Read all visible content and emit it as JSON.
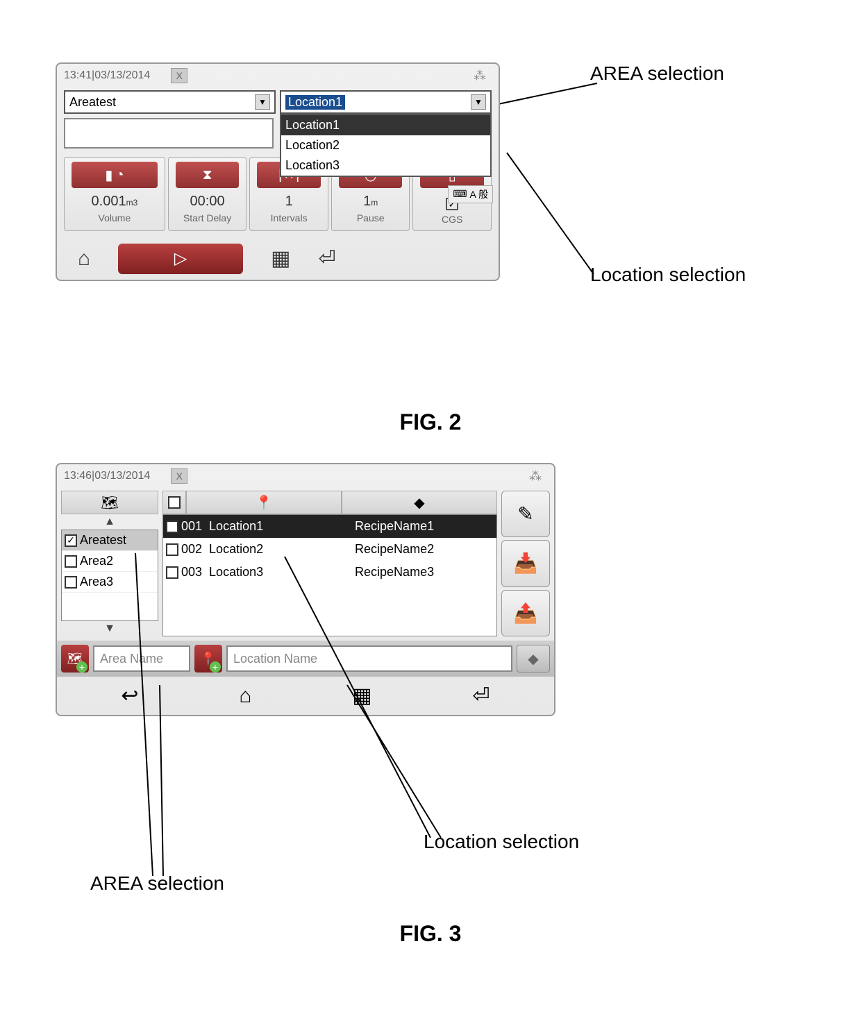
{
  "annotations": {
    "fig2_area": "AREA selection",
    "fig2_loc": "Location selection",
    "fig3_area": "AREA selection",
    "fig3_loc": "Location selection"
  },
  "fig_labels": {
    "f2": "FIG. 2",
    "f3": "FIG. 3"
  },
  "fig2": {
    "time": "13:41",
    "sep": " | ",
    "date": "03/13/2014",
    "close": "X",
    "area_dropdown": {
      "value": "Areatest"
    },
    "location_dropdown": {
      "selected": "Location1",
      "options": [
        "Location1",
        "Location2",
        "Location3"
      ]
    },
    "tiles": {
      "volume": {
        "value": "0.001",
        "unit": "m3",
        "label": "Volume"
      },
      "start_delay": {
        "value": "00:00",
        "label": "Start Delay"
      },
      "intervals": {
        "value": "1",
        "label": "Intervals"
      },
      "pause": {
        "value": "1",
        "unit": "m",
        "label": "Pause"
      },
      "cgs": {
        "label": "CGS",
        "checked": true
      }
    },
    "ime": "A 般"
  },
  "fig3": {
    "time": "13:46",
    "sep": " | ",
    "date": "03/13/2014",
    "close": "X",
    "areas": [
      {
        "name": "Areatest",
        "checked": true,
        "selected": true
      },
      {
        "name": "Area2",
        "checked": false,
        "selected": false
      },
      {
        "name": "Area3",
        "checked": false,
        "selected": false
      }
    ],
    "locations": [
      {
        "num": "001",
        "name": "Location1",
        "recipe": "RecipeName1",
        "checked": true,
        "selected": true
      },
      {
        "num": "002",
        "name": "Location2",
        "recipe": "RecipeName2",
        "checked": false,
        "selected": false
      },
      {
        "num": "003",
        "name": "Location3",
        "recipe": "RecipeName3",
        "checked": false,
        "selected": false
      }
    ],
    "area_name_placeholder": "Area Name",
    "loc_name_placeholder": "Location Name"
  }
}
